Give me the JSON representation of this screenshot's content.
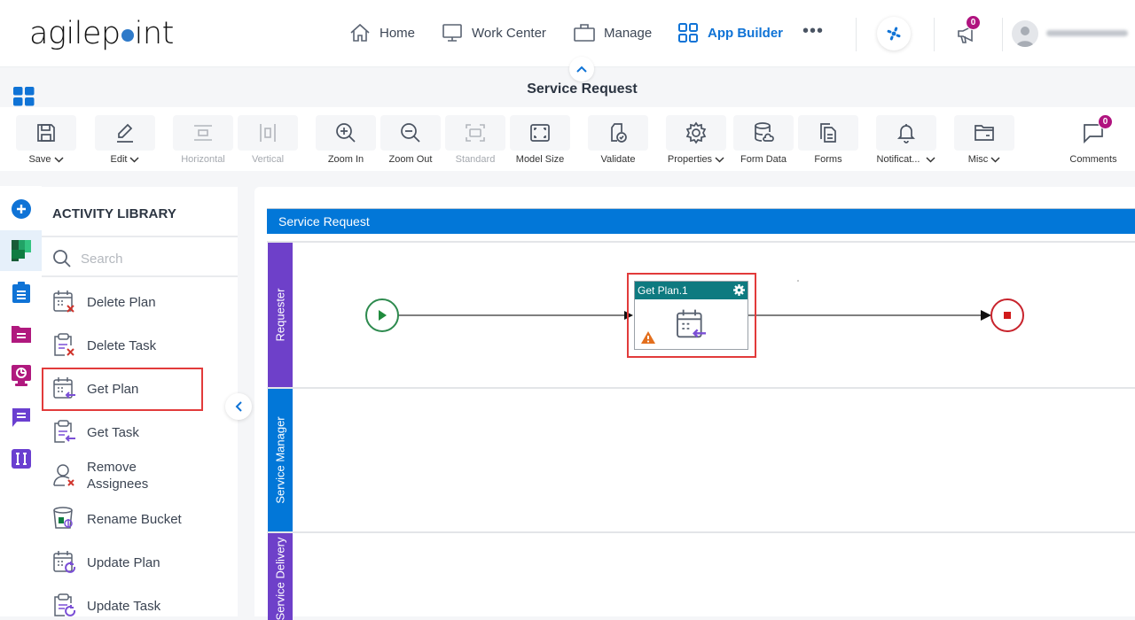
{
  "header": {
    "logo_text_pre": "agilep",
    "logo_text_post": "int",
    "nav": [
      {
        "label": "Home",
        "icon": "home-icon"
      },
      {
        "label": "Work Center",
        "icon": "monitor-icon"
      },
      {
        "label": "Manage",
        "icon": "briefcase-icon"
      },
      {
        "label": "App Builder",
        "icon": "grid-icon",
        "active": true
      }
    ],
    "more_label": "•••",
    "announcements_count": "0",
    "accent_color": "#0f73d6"
  },
  "page": {
    "title": "Service Request"
  },
  "toolbar": {
    "items": [
      {
        "label": "Save",
        "icon": "save-icon",
        "dropdown": true,
        "enabled": true
      },
      {
        "label": "Edit",
        "icon": "edit-icon",
        "dropdown": true,
        "enabled": true
      },
      {
        "label": "Horizontal",
        "icon": "horizontal-layout-icon",
        "enabled": false
      },
      {
        "label": "Vertical",
        "icon": "vertical-layout-icon",
        "enabled": false
      },
      {
        "label": "Zoom In",
        "icon": "zoom-in-icon",
        "enabled": true
      },
      {
        "label": "Zoom Out",
        "icon": "zoom-out-icon",
        "enabled": true
      },
      {
        "label": "Standard",
        "icon": "standard-size-icon",
        "enabled": false
      },
      {
        "label": "Model Size",
        "icon": "fit-size-icon",
        "enabled": true
      },
      {
        "label": "Validate",
        "icon": "validate-icon",
        "enabled": true
      },
      {
        "label": "Properties",
        "icon": "gear-icon",
        "dropdown": true,
        "enabled": true
      },
      {
        "label": "Form Data",
        "icon": "database-icon",
        "enabled": true
      },
      {
        "label": "Forms",
        "icon": "forms-icon",
        "enabled": true
      },
      {
        "label": "Notificat...",
        "icon": "bell-icon",
        "dropdown": true,
        "enabled": true
      },
      {
        "label": "Misc",
        "icon": "folder-icon",
        "dropdown": true,
        "enabled": true
      },
      {
        "label": "Comments",
        "icon": "comment-icon",
        "enabled": true,
        "badge": "0"
      }
    ]
  },
  "library": {
    "title": "ACTIVITY LIBRARY",
    "search_placeholder": "Search",
    "items": [
      {
        "label": "Delete Plan",
        "icon": "delete-plan-icon"
      },
      {
        "label": "Delete Task",
        "icon": "delete-task-icon"
      },
      {
        "label": "Get Plan",
        "icon": "get-plan-icon",
        "selected": true
      },
      {
        "label": "Get Task",
        "icon": "get-task-icon"
      },
      {
        "label": "Remove Assignees",
        "icon": "remove-assignees-icon"
      },
      {
        "label": "Rename Bucket",
        "icon": "rename-bucket-icon"
      },
      {
        "label": "Update Plan",
        "icon": "update-plan-icon"
      },
      {
        "label": "Update Task",
        "icon": "update-task-icon"
      }
    ]
  },
  "rail": {
    "items": [
      {
        "name": "add-icon",
        "color": "#0f73d6"
      },
      {
        "name": "planner-icon",
        "color": "#1f8b4c",
        "selected": true
      },
      {
        "name": "clipboard-icon",
        "color": "#0f73d6"
      },
      {
        "name": "document-folder-icon",
        "color": "#b0197e"
      },
      {
        "name": "dashboard-icon",
        "color": "#b0197e"
      },
      {
        "name": "chat-icon",
        "color": "#6a3fd0"
      },
      {
        "name": "text-field-icon",
        "color": "#6a3fd0"
      }
    ]
  },
  "canvas": {
    "pool_title": "Service Request",
    "lanes": [
      {
        "label": "Requester",
        "color": "#6e40c9"
      },
      {
        "label": "Service Manager",
        "color": "#0277d8"
      },
      {
        "label": "Service Delivery",
        "color": "#6e40c9"
      }
    ],
    "activity": {
      "title": "Get Plan.1",
      "warning": true
    }
  }
}
